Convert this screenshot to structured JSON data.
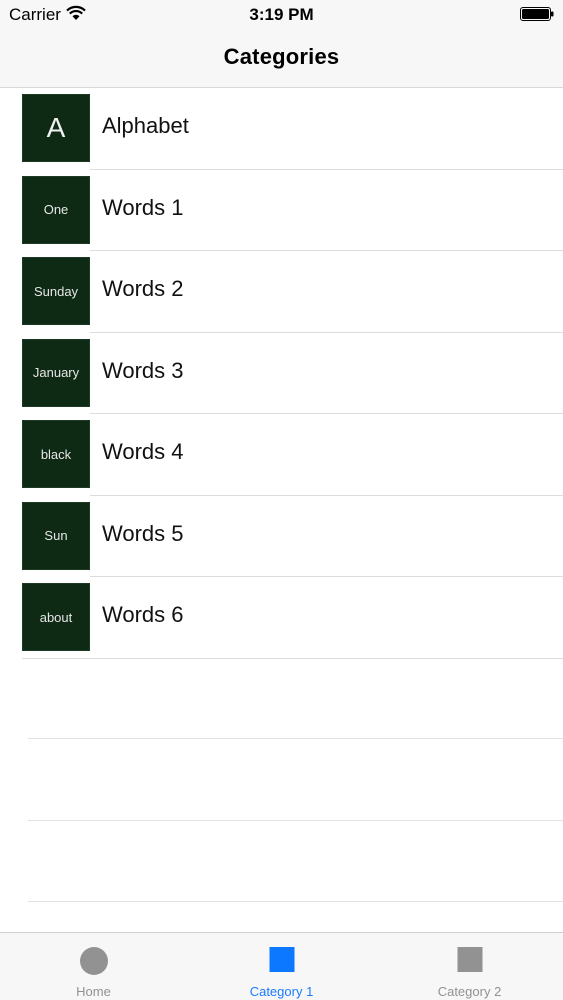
{
  "status_bar": {
    "carrier": "Carrier",
    "time": "3:19 PM"
  },
  "nav": {
    "title": "Categories"
  },
  "categories": [
    {
      "thumb": "A",
      "label": "Alphabet"
    },
    {
      "thumb": "One",
      "label": "Words 1"
    },
    {
      "thumb": "Sunday",
      "label": "Words 2"
    },
    {
      "thumb": "January",
      "label": "Words 3"
    },
    {
      "thumb": "black",
      "label": "Words 4"
    },
    {
      "thumb": "Sun",
      "label": "Words 5"
    },
    {
      "thumb": "about",
      "label": "Words 6"
    }
  ],
  "tabs": [
    {
      "label": "Home",
      "icon": "circle-icon",
      "active": false
    },
    {
      "label": "Category 1",
      "icon": "square-icon",
      "active": true
    },
    {
      "label": "Category 2",
      "icon": "square-icon",
      "active": false
    }
  ],
  "colors": {
    "accent": "#0b78ff",
    "thumb_bg": "#0e2a14",
    "inactive_tab": "#929292"
  }
}
